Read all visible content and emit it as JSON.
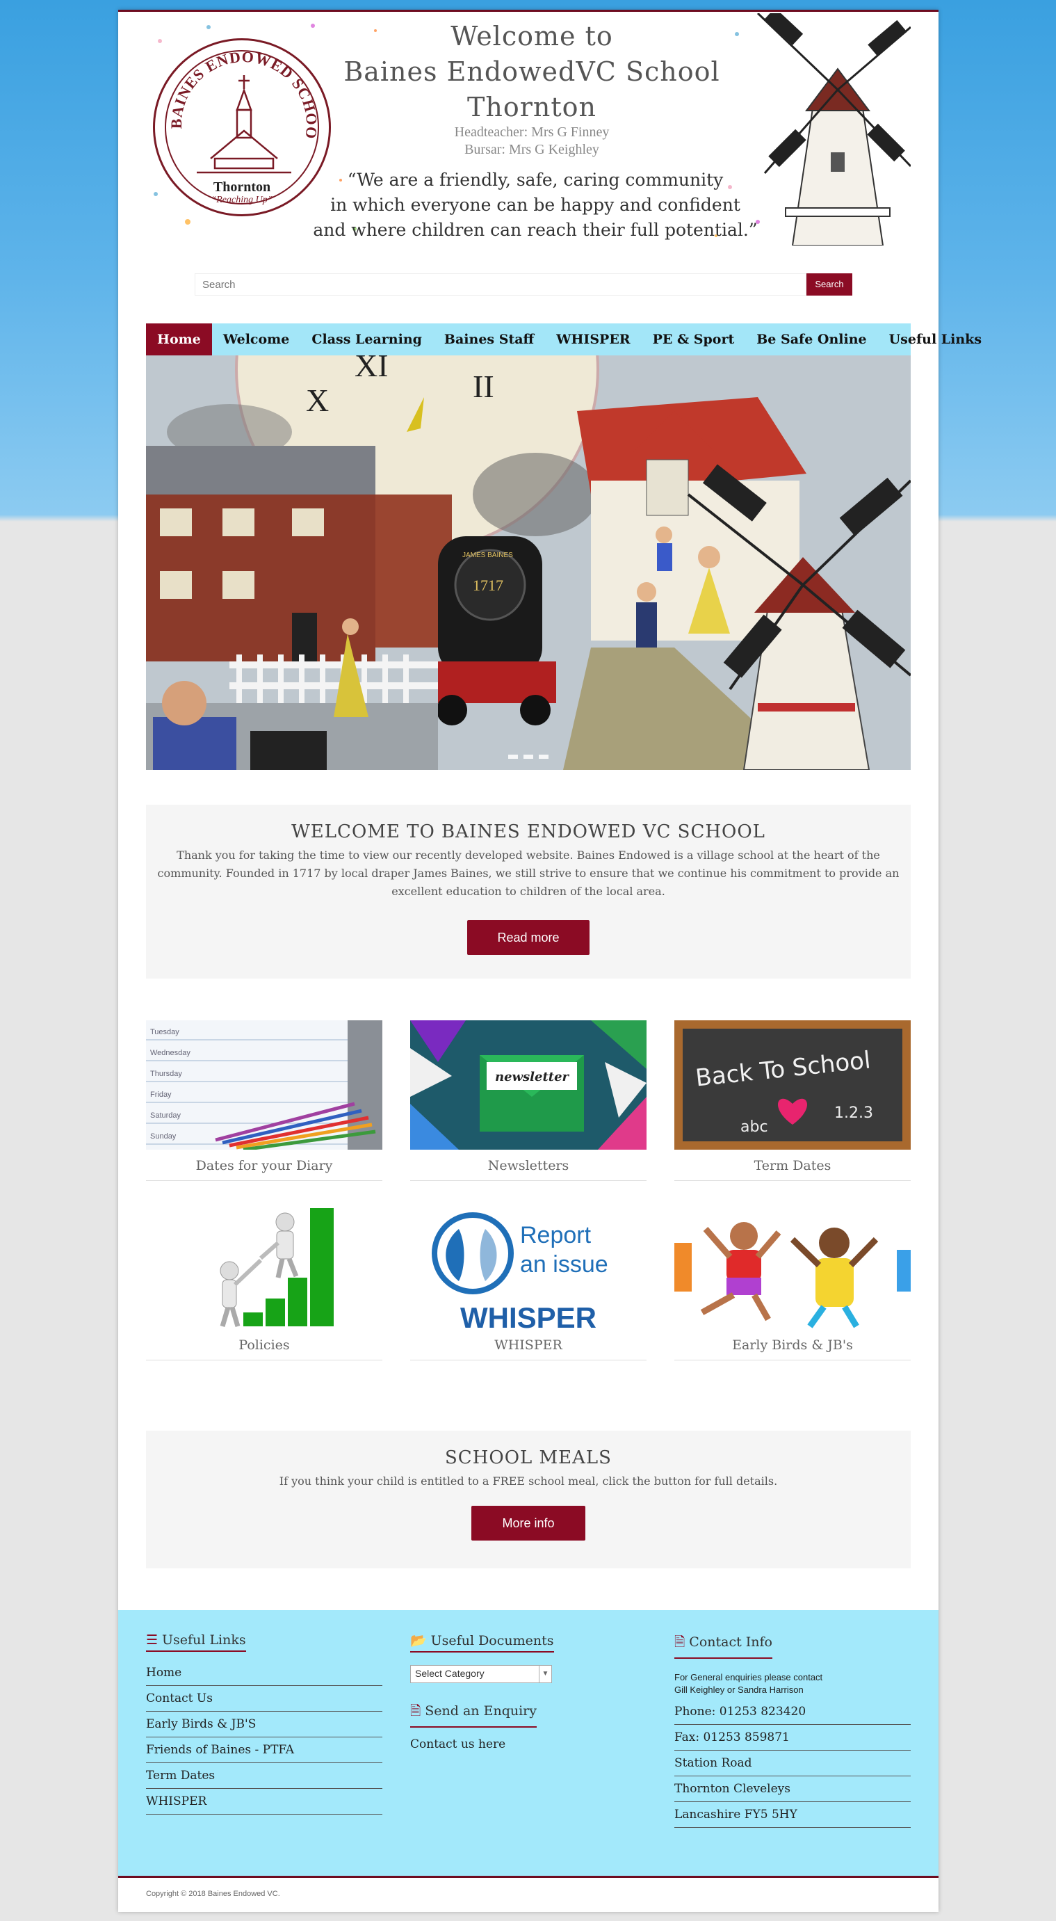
{
  "header": {
    "crest_ring_text": "BAINES ENDOWED SCHOOL",
    "crest_place": "Thornton",
    "crest_motto": "“Reaching Up”",
    "welcome_line1": "Welcome to",
    "welcome_line2": "Baines EndowedVC School",
    "welcome_line3": "Thornton",
    "headteacher": "Headteacher: Mrs G Finney",
    "bursar": "Bursar: Mrs G Keighley",
    "quote_line1": "“We are a friendly, safe, caring community",
    "quote_line2": "in which everyone can be happy and confident",
    "quote_line3": "and where children can reach their full potential.”"
  },
  "search": {
    "placeholder": "Search",
    "button_label": "Search"
  },
  "nav": {
    "items": [
      "Home",
      "Welcome",
      "Class Learning",
      "Baines Staff",
      "WHISPER",
      "PE & Sport",
      "Be Safe Online",
      "Useful Links"
    ],
    "active": "Home"
  },
  "slider": {
    "mural_year": "1717",
    "mural_plate": "JAMES BAINES"
  },
  "welcome": {
    "title": "WELCOME TO BAINES ENDOWED VC SCHOOL",
    "text": "Thank you for taking the time to view our recently developed website. Baines Endowed is a village school at the heart of the community. Founded in 1717 by local draper James Baines, we still strive to ensure that we continue his commitment to provide an excellent education to children of the local area.",
    "button": "Read more"
  },
  "tiles": [
    {
      "caption": "Dates for your Diary",
      "days": [
        "Tuesday",
        "Wednesday",
        "Thursday",
        "Friday",
        "Saturday",
        "Sunday"
      ]
    },
    {
      "caption": "Newsletters",
      "envelope_text": "newsletter"
    },
    {
      "caption": "Term Dates",
      "board_title": "Back To School",
      "board_abc": "abc",
      "board_123": "1.2.3"
    },
    {
      "caption": "Policies"
    },
    {
      "caption": "WHISPER",
      "report_line1": "Report",
      "report_line2": "an issue",
      "brand": "WHISPER"
    },
    {
      "caption": "Early Birds & JB's"
    }
  ],
  "meals": {
    "title": "SCHOOL MEALS",
    "text": "If you think your child is entitled to a FREE school meal, click the button for full details.",
    "button": "More info"
  },
  "footer": {
    "useful_links_title": "Useful Links",
    "useful_links": [
      "Home",
      "Contact Us",
      "Early Birds & JB'S",
      "Friends of Baines - PTFA",
      "Term Dates",
      "WHISPER"
    ],
    "documents_title": "Useful Documents",
    "select_value": "Select Category",
    "enquiry_title": "Send an Enquiry",
    "enquiry_link": "Contact us here",
    "contact_title": "Contact Info",
    "contact_note_line1": "For General enquiries please contact",
    "contact_note_line2": "Gill Keighley or Sandra Harrison",
    "contact_lines": [
      "Phone: 01253 823420",
      "Fax: 01253 859871",
      "Station Road",
      "Thornton Cleveleys",
      "Lancashire FY5 5HY"
    ]
  },
  "copyright": "Copyright © 2018 Baines Endowed VC.",
  "colors": {
    "accent": "#8b0b24",
    "nav_bg": "#a3e6f8",
    "footer_bg": "#a3e9fb"
  }
}
